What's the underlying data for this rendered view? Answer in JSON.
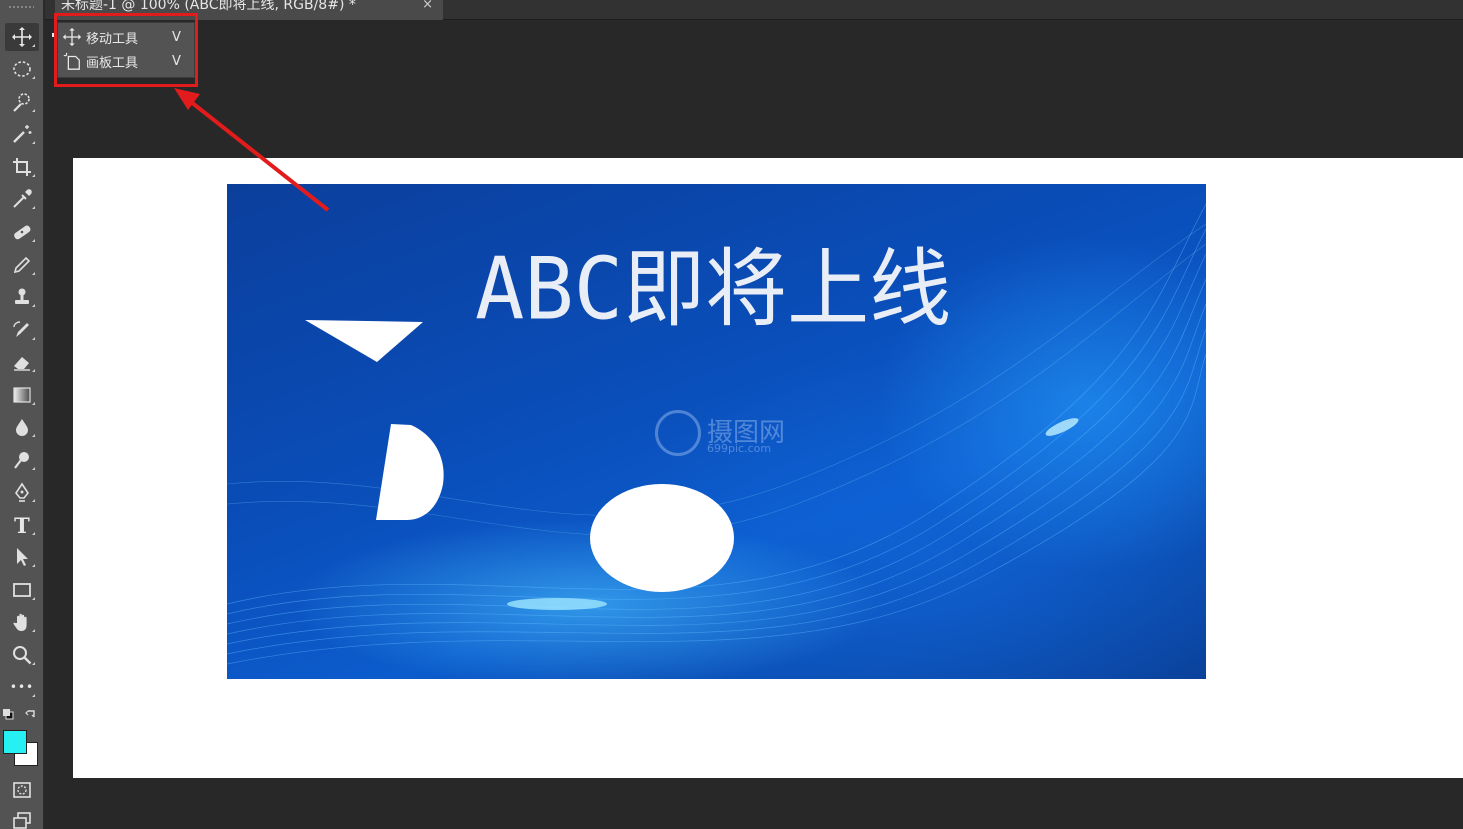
{
  "document_tab": {
    "title": "未标题-1 @ 100% (ABC即将上线, RGB/8#) *",
    "close_glyph": "×"
  },
  "toolbar": {
    "tools": [
      {
        "name": "move-tool",
        "icon": "move-icon"
      },
      {
        "name": "marquee-tool",
        "icon": "ellipse-marquee-icon"
      },
      {
        "name": "lasso-tool",
        "icon": "quick-selection-icon"
      },
      {
        "name": "magic-wand-tool",
        "icon": "magic-wand-icon"
      },
      {
        "name": "crop-tool",
        "icon": "crop-icon"
      },
      {
        "name": "eyedropper-tool",
        "icon": "eyedropper-icon"
      },
      {
        "name": "healing-brush-tool",
        "icon": "bandage-icon"
      },
      {
        "name": "brush-tool",
        "icon": "brush-icon"
      },
      {
        "name": "clone-stamp-tool",
        "icon": "stamp-icon"
      },
      {
        "name": "history-brush-tool",
        "icon": "history-brush-icon"
      },
      {
        "name": "eraser-tool",
        "icon": "eraser-icon"
      },
      {
        "name": "gradient-tool",
        "icon": "gradient-icon"
      },
      {
        "name": "blur-tool",
        "icon": "drop-icon"
      },
      {
        "name": "dodge-tool",
        "icon": "dodge-icon"
      },
      {
        "name": "pen-tool",
        "icon": "pen-icon"
      },
      {
        "name": "type-tool",
        "icon": "type-icon"
      },
      {
        "name": "path-selection-tool",
        "icon": "arrow-cursor-icon"
      },
      {
        "name": "rectangle-tool",
        "icon": "rectangle-icon"
      },
      {
        "name": "hand-tool",
        "icon": "hand-icon"
      },
      {
        "name": "zoom-tool",
        "icon": "magnifier-icon"
      },
      {
        "name": "more-tools",
        "icon": "ellipsis-icon"
      }
    ],
    "type_glyph": "T",
    "more_glyph": "•••",
    "foreground_color": "#26f0f2",
    "background_color": "#ffffff"
  },
  "flyout": {
    "items": [
      {
        "label": "移动工具",
        "shortcut": "V",
        "icon": "move-icon",
        "selected": true
      },
      {
        "label": "画板工具",
        "shortcut": "V",
        "icon": "artboard-icon",
        "selected": false
      }
    ]
  },
  "annotation": {
    "color": "#e21c1c"
  },
  "canvas": {
    "banner_title": "ABC即将上线",
    "watermark_text": "摄图网",
    "watermark_sub": "699pic.com",
    "banner_color": "#0a4db8"
  }
}
